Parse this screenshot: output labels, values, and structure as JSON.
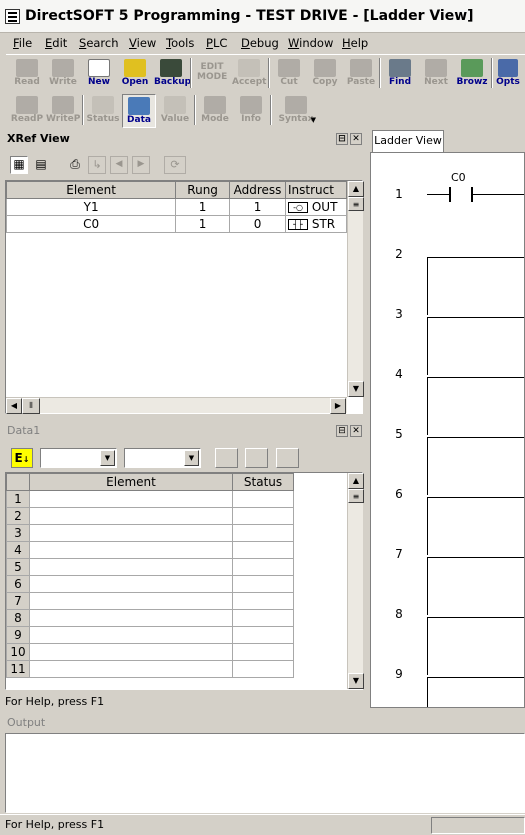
{
  "title": "DirectSOFT 5 Programming - TEST DRIVE - [Ladder View]",
  "menu": [
    {
      "u": "F",
      "rest": "ile"
    },
    {
      "u": "E",
      "rest": "dit"
    },
    {
      "u": "S",
      "rest": "earch"
    },
    {
      "u": "V",
      "rest": "iew"
    },
    {
      "u": "T",
      "rest": "ools"
    },
    {
      "u": "P",
      "rest": "LC"
    },
    {
      "u": "D",
      "rest": "ebug"
    },
    {
      "u": "W",
      "rest": "indow"
    },
    {
      "u": "H",
      "rest": "elp"
    }
  ],
  "toolbar1": [
    "Read",
    "Write",
    "New",
    "Open",
    "Backup",
    "EDIT MODE",
    "Accept",
    "Cut",
    "Copy",
    "Paste",
    "Find",
    "Next",
    "Browz",
    "Opts"
  ],
  "toolbar2": [
    "ReadP",
    "WriteP",
    "Status",
    "Data",
    "Value",
    "Mode",
    "Info",
    "Syntax"
  ],
  "xref": {
    "title": "XRef View",
    "columns": [
      "Element",
      "Rung",
      "Address",
      "Instruct"
    ],
    "rows": [
      {
        "element": "Y1",
        "rung": "1",
        "address": "1",
        "instr": "OUT"
      },
      {
        "element": "C0",
        "rung": "1",
        "address": "0",
        "instr": "STR"
      }
    ]
  },
  "data1": {
    "title": "Data1",
    "e_button": "E",
    "columns": [
      "Element",
      "Status"
    ],
    "rows": [
      "1",
      "2",
      "3",
      "4",
      "5",
      "6",
      "7",
      "8",
      "9",
      "10",
      "11"
    ]
  },
  "status_inner": "For Help, press F1",
  "output": {
    "title": "Output"
  },
  "status_bottom": "For Help, press F1",
  "ladder": {
    "tab": "Ladder View",
    "contact_label": "C0",
    "rungs": [
      "1",
      "2",
      "3",
      "4",
      "5",
      "6",
      "7",
      "8",
      "9"
    ]
  }
}
